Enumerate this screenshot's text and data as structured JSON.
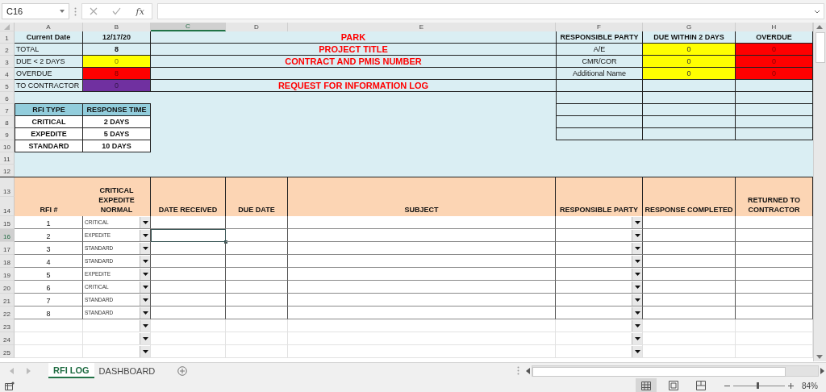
{
  "formula_bar": {
    "name_box": "C16",
    "function_label": "fx"
  },
  "columns": [
    {
      "label": "A",
      "selected": false
    },
    {
      "label": "B",
      "selected": false
    },
    {
      "label": "C",
      "selected": true
    },
    {
      "label": "D",
      "selected": false
    },
    {
      "label": "E",
      "selected": false
    },
    {
      "label": "F",
      "selected": false
    },
    {
      "label": "G",
      "selected": false
    },
    {
      "label": "H",
      "selected": false
    }
  ],
  "row_numbers": [
    {
      "label": "1",
      "selected": false
    },
    {
      "label": "2",
      "selected": false
    },
    {
      "label": "3",
      "selected": false
    },
    {
      "label": "4",
      "selected": false
    },
    {
      "label": "5",
      "selected": false
    },
    {
      "label": "6",
      "selected": false
    },
    {
      "label": "7",
      "selected": false
    },
    {
      "label": "8",
      "selected": false
    },
    {
      "label": "9",
      "selected": false
    },
    {
      "label": "10",
      "selected": false
    },
    {
      "label": "11",
      "selected": false
    },
    {
      "label": "12",
      "selected": false
    },
    {
      "label": "13",
      "selected": false
    },
    {
      "label": "14",
      "selected": false
    },
    {
      "label": "15",
      "selected": false
    },
    {
      "label": "16",
      "selected": true
    },
    {
      "label": "17",
      "selected": false
    },
    {
      "label": "18",
      "selected": false
    },
    {
      "label": "19",
      "selected": false
    },
    {
      "label": "20",
      "selected": false
    },
    {
      "label": "21",
      "selected": false
    },
    {
      "label": "22",
      "selected": false
    },
    {
      "label": "23",
      "selected": false
    },
    {
      "label": "24",
      "selected": false
    },
    {
      "label": "25",
      "selected": false
    }
  ],
  "summary": [
    {
      "label": "Current Date",
      "value": "12/17/20"
    },
    {
      "label": "TOTAL",
      "value": "8"
    },
    {
      "label": "DUE < 2 DAYS",
      "value": "0",
      "color": "#ffff00"
    },
    {
      "label": "OVERDUE",
      "value": "8",
      "color": "#ff0000"
    },
    {
      "label": "TO CONTRACTOR",
      "value": "0",
      "color": "#7030a0"
    }
  ],
  "title_block": {
    "lines": [
      "PARK",
      "PROJECT TITLE",
      "CONTRACT AND PMIS NUMBER"
    ],
    "log_title": "REQUEST FOR INFORMATION LOG"
  },
  "party_table": {
    "headers": [
      "RESPONSIBLE PARTY",
      "DUE WITHIN 2 DAYS",
      "OVERDUE"
    ],
    "rows": [
      {
        "party": "A/E",
        "due_within_2_days": "0",
        "overdue": "0"
      },
      {
        "party": "CMR/COR",
        "due_within_2_days": "0",
        "overdue": "0"
      },
      {
        "party": "Additional Name",
        "due_within_2_days": "0",
        "overdue": "0"
      }
    ]
  },
  "rfi_types": {
    "headers": [
      "RFI TYPE",
      "RESPONSE TIME"
    ],
    "rows": [
      {
        "type": "CRITICAL",
        "response_time": "2 DAYS"
      },
      {
        "type": "EXPEDITE",
        "response_time": "5 DAYS"
      },
      {
        "type": "STANDARD",
        "response_time": "10 DAYS"
      }
    ]
  },
  "log_table": {
    "headers": [
      "RFI #",
      "CRITICAL EXPEDITE NORMAL",
      "DATE RECEIVED",
      "DUE DATE",
      "SUBJECT",
      "RESPONSIBLE PARTY",
      "RESPONSE COMPLETED",
      "RETURNED TO CONTRACTOR"
    ],
    "rows": [
      {
        "rfi": "1",
        "type": "CRITICAL"
      },
      {
        "rfi": "2",
        "type": "EXPEDITE"
      },
      {
        "rfi": "3",
        "type": "STANDARD"
      },
      {
        "rfi": "4",
        "type": "STANDARD"
      },
      {
        "rfi": "5",
        "type": "EXPEDITE"
      },
      {
        "rfi": "6",
        "type": "CRITICAL"
      },
      {
        "rfi": "7",
        "type": "STANDARD"
      },
      {
        "rfi": "8",
        "type": "STANDARD"
      }
    ]
  },
  "sheet_tabs": [
    {
      "label": "RFI LOG",
      "selected": true
    },
    {
      "label": "DASHBOARD",
      "selected": false
    }
  ],
  "view_buttons": [
    {
      "kind": "normal",
      "selected": true
    },
    {
      "kind": "page_layout",
      "selected": false
    },
    {
      "kind": "page_break_preview",
      "selected": false
    }
  ],
  "zoom": {
    "reading": "84%",
    "level": 0.45
  }
}
